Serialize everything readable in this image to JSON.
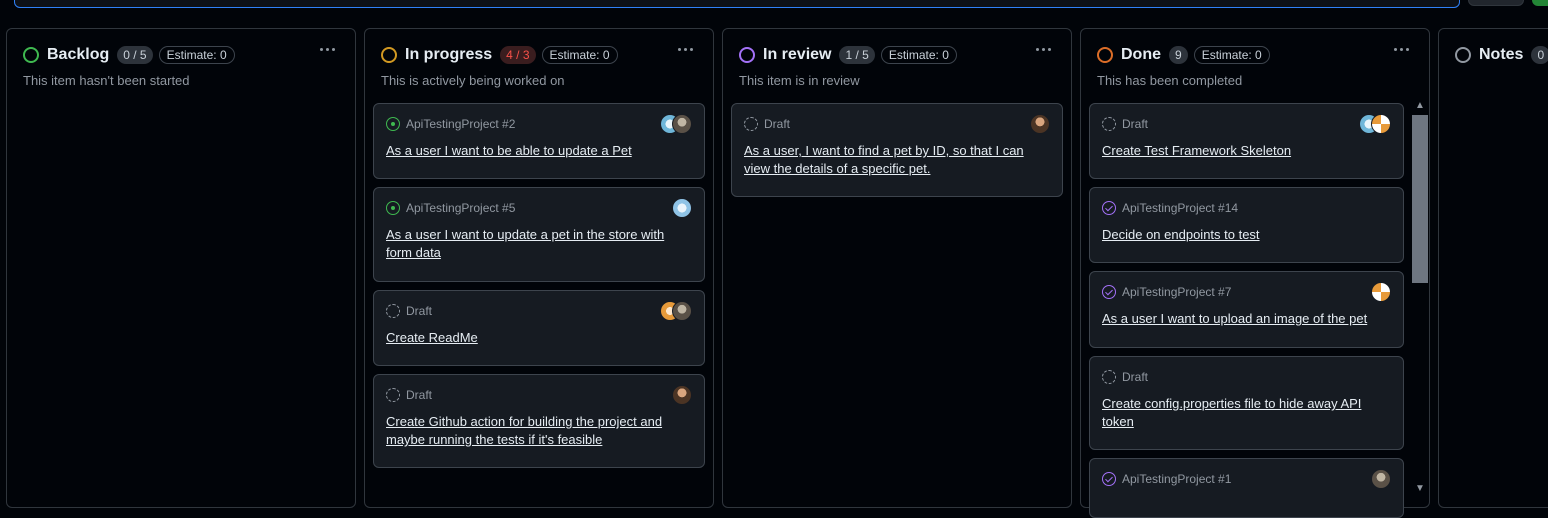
{
  "columns": [
    {
      "title": "Backlog",
      "count": "0 / 5",
      "estimate": "Estimate: 0",
      "description": "This item hasn't been started",
      "color": "#3fb950",
      "over_limit": false,
      "cards": []
    },
    {
      "title": "In progress",
      "count": "4 / 3",
      "estimate": "Estimate: 0",
      "description": "This is actively being worked on",
      "color": "#d29922",
      "over_limit": true,
      "cards": [
        {
          "status": "open-issue",
          "ref": "ApiTestingProject #2",
          "title": "As a user I want to be able to update a Pet",
          "avatars": [
            "av-teal",
            "av-gray"
          ]
        },
        {
          "status": "open-issue",
          "ref": "ApiTestingProject #5",
          "title": "As a user I want to update a pet in the store with form data",
          "avatars": [
            "av-blue"
          ]
        },
        {
          "status": "draft",
          "ref": "Draft",
          "title": "Create ReadMe",
          "avatars": [
            "av-orange",
            "av-gray"
          ]
        },
        {
          "status": "draft",
          "ref": "Draft",
          "title": "Create Github action for building the project and maybe running the tests if it's feasible",
          "avatars": [
            "av-face"
          ]
        }
      ]
    },
    {
      "title": "In review",
      "count": "1 / 5",
      "estimate": "Estimate: 0",
      "description": "This item is in review",
      "color": "#a371f7",
      "over_limit": false,
      "cards": [
        {
          "status": "draft",
          "ref": "Draft",
          "title": "As a user, I want to find a pet by ID, so that I can view the details of a specific pet.",
          "avatars": [
            "av-face"
          ]
        }
      ]
    },
    {
      "title": "Done",
      "count": "9",
      "estimate": "Estimate: 0",
      "description": "This has been completed",
      "color": "#db6d28",
      "over_limit": false,
      "cards": [
        {
          "status": "draft",
          "ref": "Draft",
          "title": "Create Test Framework Skeleton",
          "avatars": [
            "av-teal",
            "av-ident"
          ]
        },
        {
          "status": "closed-issue",
          "ref": "ApiTestingProject #14",
          "title": "Decide on endpoints to test",
          "avatars": []
        },
        {
          "status": "closed-issue",
          "ref": "ApiTestingProject #7",
          "title": "As a user I want to upload an image of the pet",
          "avatars": [
            "av-ident"
          ]
        },
        {
          "status": "draft",
          "ref": "Draft",
          "title": "Create config.properties file to hide away API token",
          "avatars": []
        },
        {
          "status": "closed-issue",
          "ref": "ApiTestingProject #1",
          "title": "",
          "avatars": [
            "av-gray"
          ]
        }
      ]
    },
    {
      "title": "Notes",
      "count": "0",
      "estimate": "",
      "description": "",
      "color": "#9198a1",
      "over_limit": false,
      "cards": []
    }
  ]
}
